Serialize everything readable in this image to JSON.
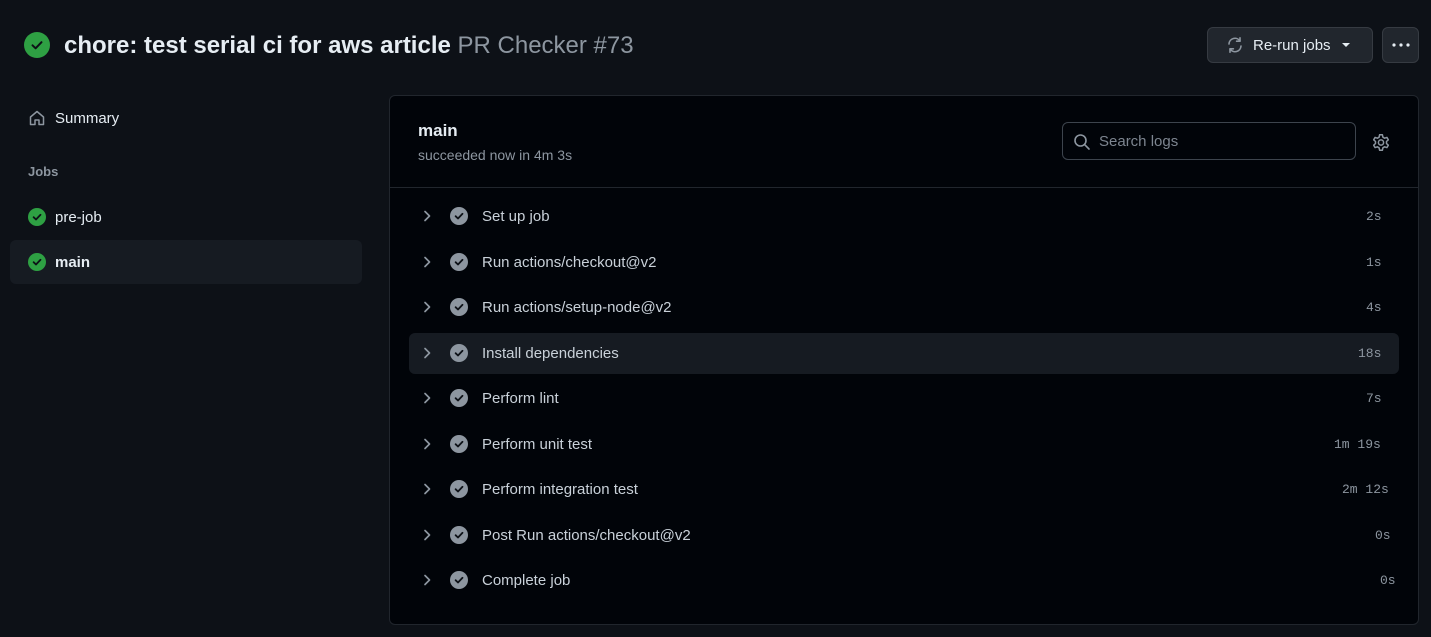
{
  "header": {
    "title": "chore: test serial ci for aws article",
    "workflow": "PR Checker #73",
    "rerun_label": "Re-run jobs"
  },
  "sidebar": {
    "summary_label": "Summary",
    "jobs_heading": "Jobs",
    "jobs": [
      {
        "label": "pre-job",
        "status": "success"
      },
      {
        "label": "main",
        "status": "success",
        "active": true
      }
    ]
  },
  "job": {
    "title": "main",
    "meta": "succeeded now in 4m 3s",
    "search_placeholder": "Search logs",
    "steps": [
      {
        "name": "Set up job",
        "duration": "2s"
      },
      {
        "name": "Run actions/checkout@v2",
        "duration": "1s"
      },
      {
        "name": "Run actions/setup-node@v2",
        "duration": "4s"
      },
      {
        "name": "Install dependencies",
        "duration": "18s"
      },
      {
        "name": "Perform lint",
        "duration": "7s"
      },
      {
        "name": "Perform unit test",
        "duration": "1m 19s"
      },
      {
        "name": "Perform integration test",
        "duration": "2m 12s"
      },
      {
        "name": "Post Run actions/checkout@v2",
        "duration": "0s"
      },
      {
        "name": "Complete job",
        "duration": "0s"
      }
    ]
  },
  "colors": {
    "background": "#0d1117",
    "success": "#2ea043",
    "muted": "#8d96a0"
  },
  "icons": [
    "check-circle-icon",
    "sync-icon",
    "caret-down-icon",
    "kebab-icon",
    "home-icon",
    "search-icon",
    "gear-icon",
    "chevron-right-icon"
  ]
}
